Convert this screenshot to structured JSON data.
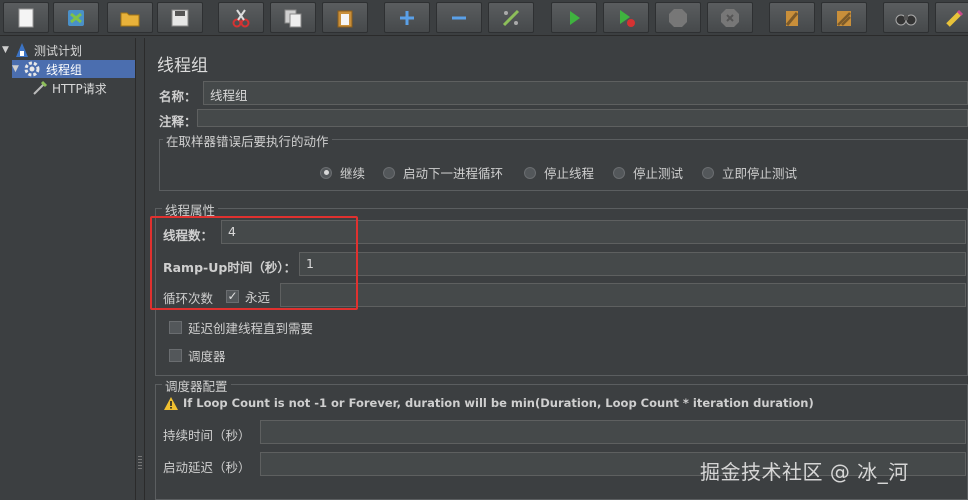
{
  "tree": {
    "items": [
      {
        "label": "测试计划"
      },
      {
        "label": "线程组"
      },
      {
        "label": "HTTP请求"
      }
    ]
  },
  "panel": {
    "title": "线程组",
    "name_label": "名称：",
    "name_value": "线程组",
    "comment_label": "注释：",
    "comment_value": "",
    "error_action": {
      "legend": "在取样器错误后要执行的动作",
      "options": [
        "继续",
        "启动下一进程循环",
        "停止线程",
        "停止测试",
        "立即停止测试"
      ],
      "selected": "继续"
    },
    "thread_props": {
      "legend": "线程属性",
      "threads_label": "线程数：",
      "threads_value": "4",
      "rampup_label": "Ramp-Up时间（秒）：",
      "rampup_value": "1",
      "loop_label": "循环次数",
      "forever_label": "永远",
      "forever_checked": true,
      "loop_value": "",
      "delay_label": "延迟创建线程直到需要",
      "delay_checked": false,
      "scheduler_label": "调度器",
      "scheduler_checked": false
    },
    "scheduler_config": {
      "legend": "调度器配置",
      "warning": "If Loop Count is not -1 or Forever, duration will be min(Duration, Loop Count * iteration duration)",
      "duration_label": "持续时间（秒）",
      "duration_value": "",
      "delay_label": "启动延迟（秒）",
      "delay_value": ""
    }
  },
  "watermark": "掘金技术社区 @ 冰_河",
  "colors": {
    "highlight": "#e0312f",
    "selection": "#4b6eaf"
  }
}
